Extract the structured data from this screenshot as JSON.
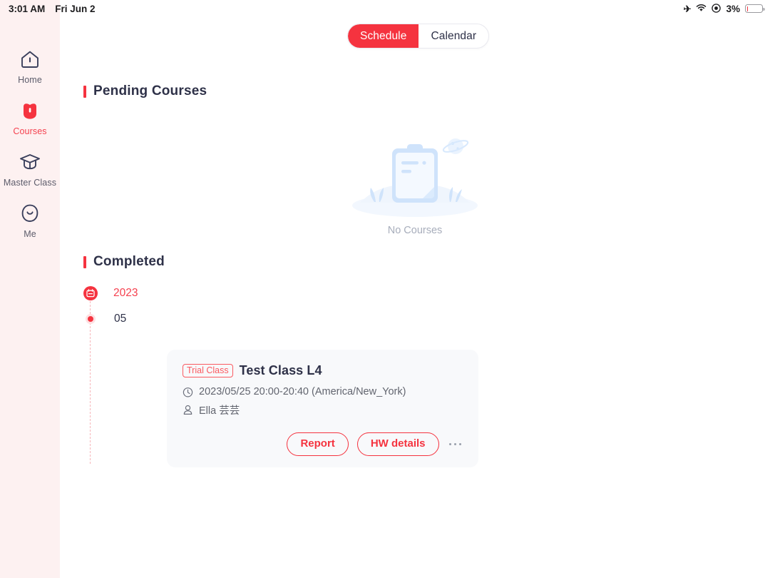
{
  "statusbar": {
    "time": "3:01 AM",
    "date": "Fri Jun 2",
    "airplane_icon": "airplane-mode-icon",
    "wifi_icon": "wifi-icon",
    "location_icon": "location-services-icon",
    "battery_percent": "3%",
    "battery_level": 3
  },
  "sidebar": {
    "items": [
      {
        "label": "Home",
        "icon": "home-icon",
        "active": false
      },
      {
        "label": "Courses",
        "icon": "courses-icon",
        "active": true
      },
      {
        "label": "Master Class",
        "icon": "graduation-cap-icon",
        "active": false
      },
      {
        "label": "Me",
        "icon": "profile-face-icon",
        "active": false
      }
    ]
  },
  "toggle": {
    "schedule_label": "Schedule",
    "calendar_label": "Calendar",
    "selected": "Schedule"
  },
  "pending": {
    "title": "Pending Courses",
    "empty_caption": "No Courses",
    "empty_illustration": "clipboard-empty-illustration"
  },
  "completed": {
    "title": "Completed",
    "year": "2023",
    "month": "05",
    "card": {
      "badge": "Trial Class",
      "title": "Test Class L4",
      "time": "2023/05/25 20:00-20:40 (America/New_York)",
      "teacher": "Ella 芸芸",
      "clock_icon": "clock-icon",
      "person_icon": "person-icon",
      "report_label": "Report",
      "hw_label": "HW details",
      "more_label": "more-options"
    }
  },
  "colors": {
    "accent": "#f5333f",
    "accent_soft": "#fa5a60",
    "sidebar_bg": "#fdf1f1",
    "text_dark": "#2e3148",
    "text_muted": "#62656f",
    "card_bg": "#f8f9fb"
  }
}
